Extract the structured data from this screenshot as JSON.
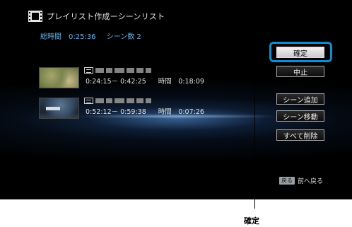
{
  "header": {
    "title": "プレイリスト作成ーシーンリスト",
    "icon": "film-strip-icon"
  },
  "summary": {
    "total_time": "総時間　0:25:36",
    "scene_count": "シーン数 2"
  },
  "scenes": [
    {
      "range": "0:24:15－ 0:42:25",
      "duration": "時間　0:18:09"
    },
    {
      "range": "0:52:12－ 0:59:38",
      "duration": "時間　0:07:26"
    }
  ],
  "buttons": {
    "confirm": "確定",
    "cancel": "中止",
    "add_scene": "シーン追加",
    "move_scene": "シーン移動",
    "delete_all": "すべて削除"
  },
  "hint": {
    "key": "戻る",
    "text": "前へ戻る"
  },
  "callout": {
    "label": "確定"
  },
  "colors": {
    "focus_ring": "#0b8fd2",
    "summary_text": "#6ab4e8"
  }
}
